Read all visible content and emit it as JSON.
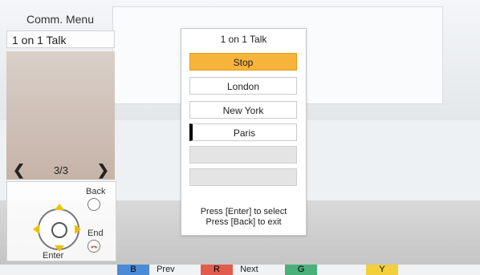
{
  "comm_menu": {
    "title": "Comm. Menu",
    "current_item": "1 on 1 Talk"
  },
  "pager": {
    "text": "3/3"
  },
  "controls": {
    "back_label": "Back",
    "end_label": "End",
    "enter_label": "Enter"
  },
  "dialog": {
    "title": "1 on 1 Talk",
    "options": [
      {
        "label": "Stop"
      },
      {
        "label": "London"
      },
      {
        "label": "New York"
      },
      {
        "label": "Paris"
      },
      {
        "label": ""
      },
      {
        "label": ""
      }
    ],
    "instructions": {
      "line1": "Press [Enter] to select",
      "line2": "Press [Back] to exit"
    }
  },
  "color_keys": {
    "blue": {
      "key": "B",
      "label": "Prev",
      "color": "#4a8ad6"
    },
    "red": {
      "key": "R",
      "label": "Next",
      "color": "#e25b4f"
    },
    "green": {
      "key": "G",
      "color": "#49b07a"
    },
    "yellow": {
      "key": "Y",
      "color": "#f2cf3b"
    }
  }
}
